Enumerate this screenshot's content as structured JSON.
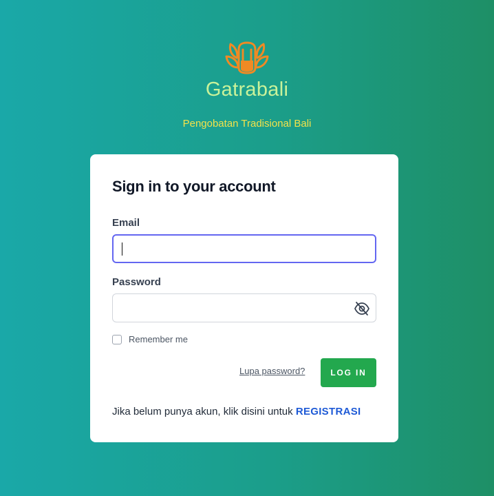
{
  "brand": {
    "name": "Gatrabali",
    "tagline": "Pengobatan Tradisional Bali",
    "logo_icon": "leaf-jar-icon",
    "colors": {
      "name": "#c9f29a",
      "tagline": "#f3e24a",
      "logo": "#f08a24"
    }
  },
  "login": {
    "title": "Sign in to your account",
    "email_label": "Email",
    "email_value": "",
    "password_label": "Password",
    "password_value": "",
    "password_toggle_icon": "eye-off-icon",
    "remember_label": "Remember me",
    "remember_checked": false,
    "forgot_label": "Lupa password?",
    "login_label": "LOG IN",
    "register_prompt": "Jika belum punya akun, klik disini untuk",
    "register_link": "REGISTRASI",
    "colors": {
      "button": "#23a84e",
      "link": "#1e5ad6",
      "focus": "#6366f1"
    }
  }
}
